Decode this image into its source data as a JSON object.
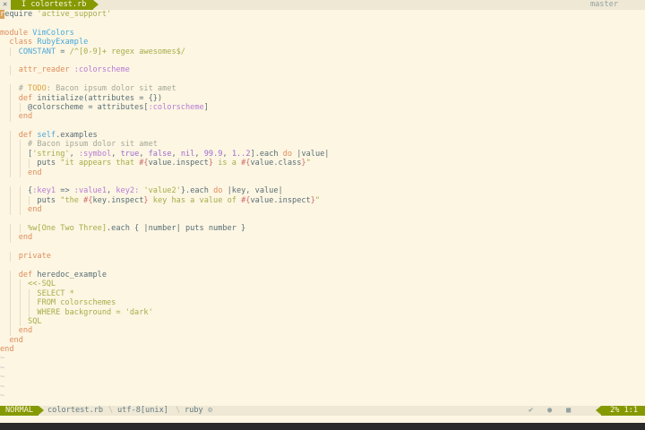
{
  "tabline": {
    "close_glyph": "✕",
    "tab_label": "I colortest.rb",
    "branch": "master"
  },
  "code_lines": [
    [
      {
        "t": "r",
        "c": "cursor"
      },
      {
        "t": "equire "
      },
      {
        "t": "'active_support'",
        "c": "str"
      }
    ],
    [],
    [
      {
        "t": "module ",
        "c": "kw"
      },
      {
        "t": "VimColors",
        "c": "cls"
      }
    ],
    [
      {
        "t": "  class ",
        "c": "kw"
      },
      {
        "t": "RubyExample",
        "c": "cls"
      }
    ],
    [
      {
        "t": "    CONSTANT",
        "c": "cls"
      },
      {
        "t": " = "
      },
      {
        "t": "/^[0-9]+ regex awesomes$/",
        "c": "str"
      }
    ],
    [],
    [
      {
        "t": "    attr_reader ",
        "c": "kw"
      },
      {
        "t": ":colorscheme",
        "c": "sym"
      }
    ],
    [],
    [
      {
        "t": "    # ",
        "c": "cmt"
      },
      {
        "t": "TODO",
        "c": "todo"
      },
      {
        "t": ": Bacon ipsum dolor sit amet",
        "c": "cmt"
      }
    ],
    [
      {
        "t": "    def ",
        "c": "kw"
      },
      {
        "t": "initialize(attributes = {})"
      }
    ],
    [
      {
        "t": "      @colorscheme",
        "c": "iv"
      },
      {
        "t": " = attributes["
      },
      {
        "t": ":colorscheme",
        "c": "sym"
      },
      {
        "t": "]"
      }
    ],
    [
      {
        "t": "    end",
        "c": "kw"
      }
    ],
    [],
    [
      {
        "t": "    def ",
        "c": "kw"
      },
      {
        "t": "self",
        "c": "cls"
      },
      {
        "t": ".examples"
      }
    ],
    [
      {
        "t": "      # Bacon ipsum dolor sit amet",
        "c": "cmt"
      }
    ],
    [
      {
        "t": "      ["
      },
      {
        "t": "'string'",
        "c": "str"
      },
      {
        "t": ", "
      },
      {
        "t": ":symbol",
        "c": "sym"
      },
      {
        "t": ", "
      },
      {
        "t": "true",
        "c": "num"
      },
      {
        "t": ", "
      },
      {
        "t": "false",
        "c": "num"
      },
      {
        "t": ", "
      },
      {
        "t": "nil",
        "c": "num"
      },
      {
        "t": ", "
      },
      {
        "t": "99.9",
        "c": "num"
      },
      {
        "t": ", "
      },
      {
        "t": "1..2",
        "c": "num"
      },
      {
        "t": "].each "
      },
      {
        "t": "do",
        "c": "kw"
      },
      {
        "t": " |value|"
      }
    ],
    [
      {
        "t": "        puts "
      },
      {
        "t": "\"it appears that ",
        "c": "str"
      },
      {
        "t": "#{",
        "c": "interp"
      },
      {
        "t": "value.inspect"
      },
      {
        "t": "}",
        "c": "interp"
      },
      {
        "t": " is a ",
        "c": "str"
      },
      {
        "t": "#{",
        "c": "interp"
      },
      {
        "t": "value.class"
      },
      {
        "t": "}",
        "c": "interp"
      },
      {
        "t": "\"",
        "c": "str"
      }
    ],
    [
      {
        "t": "      end",
        "c": "kw"
      }
    ],
    [],
    [
      {
        "t": "      {"
      },
      {
        "t": ":key1",
        "c": "sym"
      },
      {
        "t": " => "
      },
      {
        "t": ":value1",
        "c": "sym"
      },
      {
        "t": ", "
      },
      {
        "t": "key2:",
        "c": "sym"
      },
      {
        "t": " "
      },
      {
        "t": "'value2'",
        "c": "str"
      },
      {
        "t": "}.each "
      },
      {
        "t": "do",
        "c": "kw"
      },
      {
        "t": " |key, value|"
      }
    ],
    [
      {
        "t": "        puts "
      },
      {
        "t": "\"the ",
        "c": "str"
      },
      {
        "t": "#{",
        "c": "interp"
      },
      {
        "t": "key.inspect"
      },
      {
        "t": "}",
        "c": "interp"
      },
      {
        "t": " key has a value of ",
        "c": "str"
      },
      {
        "t": "#{",
        "c": "interp"
      },
      {
        "t": "value.inspect"
      },
      {
        "t": "}",
        "c": "interp"
      },
      {
        "t": "\"",
        "c": "str"
      }
    ],
    [
      {
        "t": "      end",
        "c": "kw"
      }
    ],
    [],
    [
      {
        "t": "      %w[One Two Three]",
        "c": "str"
      },
      {
        "t": ".each { |number| puts number }"
      }
    ],
    [
      {
        "t": "    end",
        "c": "kw"
      }
    ],
    [],
    [
      {
        "t": "    private",
        "c": "kw"
      }
    ],
    [],
    [
      {
        "t": "    def ",
        "c": "kw"
      },
      {
        "t": "heredoc_example"
      }
    ],
    [
      {
        "t": "      <<-SQL",
        "c": "str"
      }
    ],
    [
      {
        "t": "        SELECT *",
        "c": "str"
      }
    ],
    [
      {
        "t": "        FROM colorschemes",
        "c": "str"
      }
    ],
    [
      {
        "t": "        WHERE background = 'dark'",
        "c": "str"
      }
    ],
    [
      {
        "t": "      SQL",
        "c": "str"
      }
    ],
    [
      {
        "t": "    end",
        "c": "kw"
      }
    ],
    [
      {
        "t": "  end",
        "c": "kw"
      }
    ],
    [
      {
        "t": "end",
        "c": "kw"
      }
    ],
    [
      {
        "t": "~",
        "c": "tilde"
      }
    ],
    [
      {
        "t": "~",
        "c": "tilde"
      }
    ],
    [
      {
        "t": "~",
        "c": "tilde"
      }
    ],
    [
      {
        "t": "~",
        "c": "tilde"
      }
    ],
    [
      {
        "t": "~",
        "c": "tilde"
      }
    ]
  ],
  "statusline": {
    "mode": "NORMAL",
    "filename": "colortest.rb",
    "encoding": "utf-8[unix]",
    "filetype": "ruby",
    "position": "2%  1:1"
  }
}
